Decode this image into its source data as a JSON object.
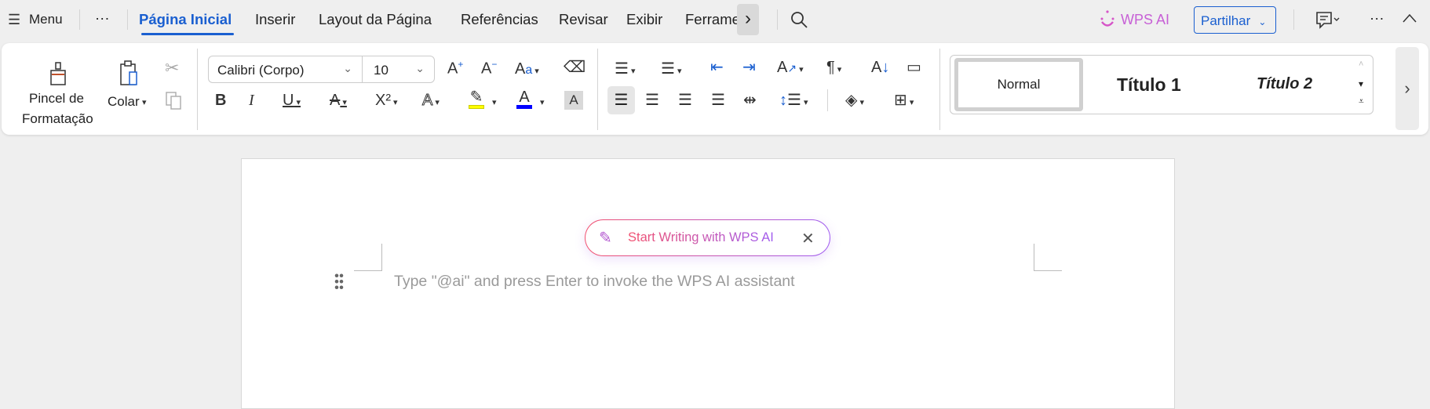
{
  "topbar": {
    "menu_label": "Menu",
    "more": "···",
    "tabs": [
      "Página Inicial",
      "Inserir",
      "Layout da Página",
      "Referências",
      "Revisar",
      "Exibir",
      "Ferrame"
    ],
    "active_tab": "Página Inicial",
    "scroll_right": "›",
    "wps_ai": "WPS AI",
    "share": "Partilhar",
    "share_caret": "⌄",
    "more_right": "···",
    "collapse": "^"
  },
  "ribbon": {
    "format_painter": [
      "Pincel de",
      "Formatação"
    ],
    "paste": "Colar",
    "font_name": "Calibri (Corpo)",
    "font_size": "10",
    "styles": [
      "Normal",
      "Título 1",
      "Título 2"
    ]
  },
  "document": {
    "ai_prompt": "Start Writing with WPS AI",
    "placeholder": "Type \"@ai\" and press Enter to invoke the WPS AI assistant"
  },
  "colors": {
    "accent": "#1a5fd0",
    "highlight": "#ffff00",
    "font_color": "#0000ff",
    "ai_start": "#f2506e",
    "ai_end": "#a05cf0"
  }
}
